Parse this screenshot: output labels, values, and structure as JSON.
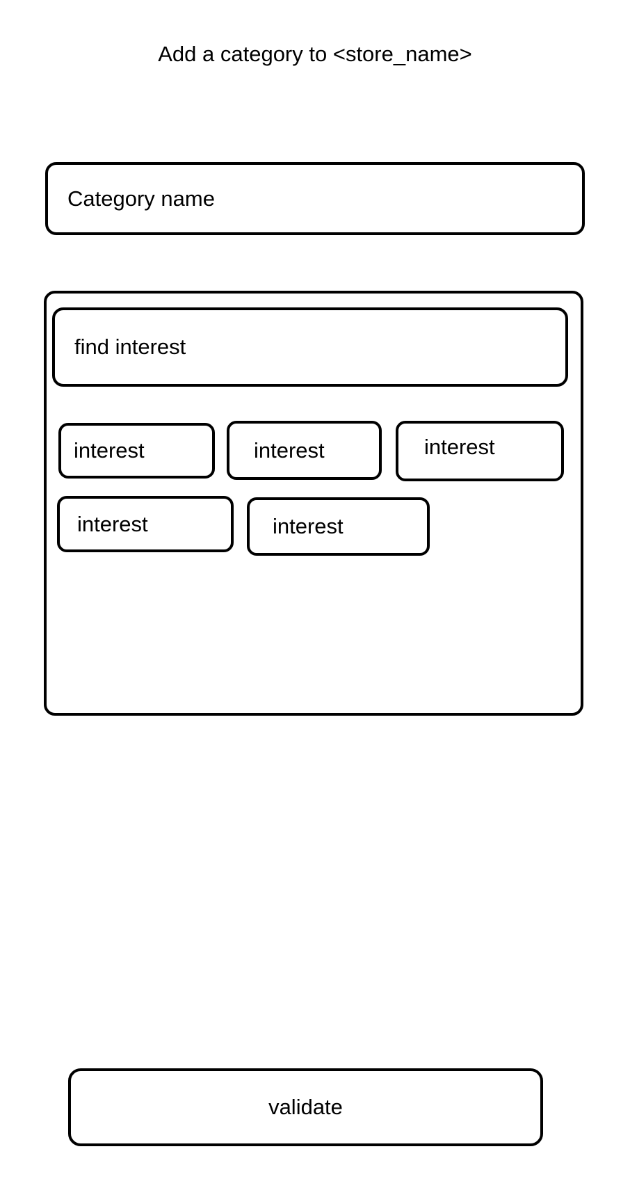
{
  "header": {
    "title": "Add a category to <store_name>"
  },
  "form": {
    "category_name_placeholder": "Category name",
    "interest_search_placeholder": "find interest",
    "interests": [
      "interest",
      "interest",
      "interest",
      "interest",
      "interest"
    ],
    "validate_label": "validate"
  }
}
